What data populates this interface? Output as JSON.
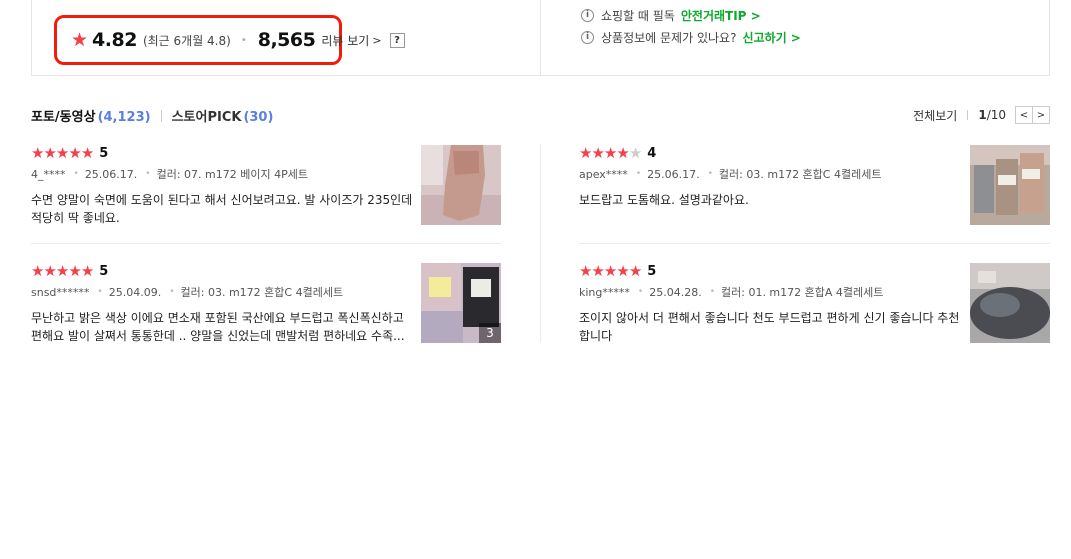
{
  "summary": {
    "average": "4.82",
    "recent": "(최근 6개월 4.8)",
    "review_count": "8,565",
    "review_link": "리뷰 보기",
    "help": "?",
    "info_lines": [
      {
        "text": "쇼핑할 때 필독",
        "link": "안전거래TIP"
      },
      {
        "text": "상품정보에 문제가 있나요?",
        "link": "신고하기"
      }
    ]
  },
  "tabs": [
    {
      "label": "포토/동영상",
      "count": "(4,123)"
    },
    {
      "label": "스토어PICK",
      "count": "(30)"
    }
  ],
  "pager": {
    "view_all": "전체보기",
    "current": "1",
    "total": "/10",
    "prev": "<",
    "next": ">"
  },
  "reviews": [
    {
      "rating": 5,
      "score": "5",
      "user": "4_****",
      "date": "25.06.17.",
      "option": "컬러: 07. m172 베이지 4P세트",
      "text": "수면 양말이 숙면에 도움이 된다고 해서 신어보려고요. 발 사이즈가 235인데 적당히 딱 좋네요.",
      "photo_count": ""
    },
    {
      "rating": 4,
      "score": "4",
      "user": "apex****",
      "date": "25.06.17.",
      "option": "컬러: 03. m172 혼합C 4켤레세트",
      "text": "보드랍고 도톰해요. 설명과같아요.",
      "photo_count": ""
    },
    {
      "rating": 5,
      "score": "5",
      "user": "snsd******",
      "date": "25.04.09.",
      "option": "컬러: 03. m172 혼합C 4켤레세트",
      "text": "무난하고 밝은 색상 이에요 면소재 포함된 국산에요 부드럽고 폭신폭신하고 편해요 발이 살쪄서 통통한데 .. 양말을 신었는데 맨발처럼 편하네요 수족...",
      "photo_count": "3"
    },
    {
      "rating": 5,
      "score": "5",
      "user": "king*****",
      "date": "25.04.28.",
      "option": "컬러: 01. m172 혼합A 4켤레세트",
      "text": "조이지 않아서 더 편해서 좋습니다 천도 부드럽고 편하게 신기 좋습니다 추천합니다",
      "photo_count": ""
    }
  ],
  "icons": {
    "star": "★",
    "info": "i",
    "chevron_right": "›"
  },
  "colors": {
    "star": "#f3404b",
    "highlight": "#f21c0c",
    "link_green": "#0aaa2a",
    "count_blue": "#5b7fe0"
  }
}
